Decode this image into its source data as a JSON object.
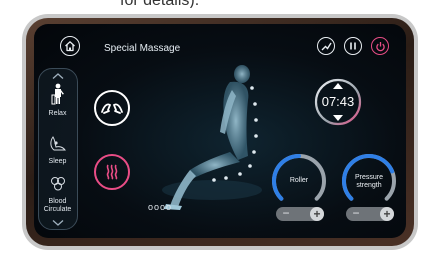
{
  "caption": "for details).",
  "header": {
    "title": "Special  Massage"
  },
  "icons": {
    "home": "home-icon",
    "chart": "trend-icon",
    "pause": "pause-icon",
    "power": "power-icon",
    "hands": "massage-hands-icon",
    "heat": "heat-waves-icon"
  },
  "sidebar": {
    "items": [
      {
        "label": "Relax",
        "icon": "relax-person-icon"
      },
      {
        "label": "Sleep",
        "icon": "sleep-person-icon"
      },
      {
        "label": "Blood\nCirculate",
        "label_line1": "Blood",
        "label_line2": "Circulate",
        "icon": "circulation-icon"
      }
    ]
  },
  "figure": {
    "position_dots_label": "oooo"
  },
  "timer": {
    "value": "07:43"
  },
  "controls": {
    "roller": {
      "label": "Roller",
      "minus": "−",
      "plus": "+",
      "level": 0.5
    },
    "pressure": {
      "label_line1": "Pressure",
      "label_line2": "strength",
      "minus": "−",
      "plus": "+",
      "level": 0.75
    }
  },
  "colors": {
    "accent_pink": "#e94d86",
    "gauge_blue": "#2f7fe6",
    "gauge_grey": "#9aa3ab"
  }
}
